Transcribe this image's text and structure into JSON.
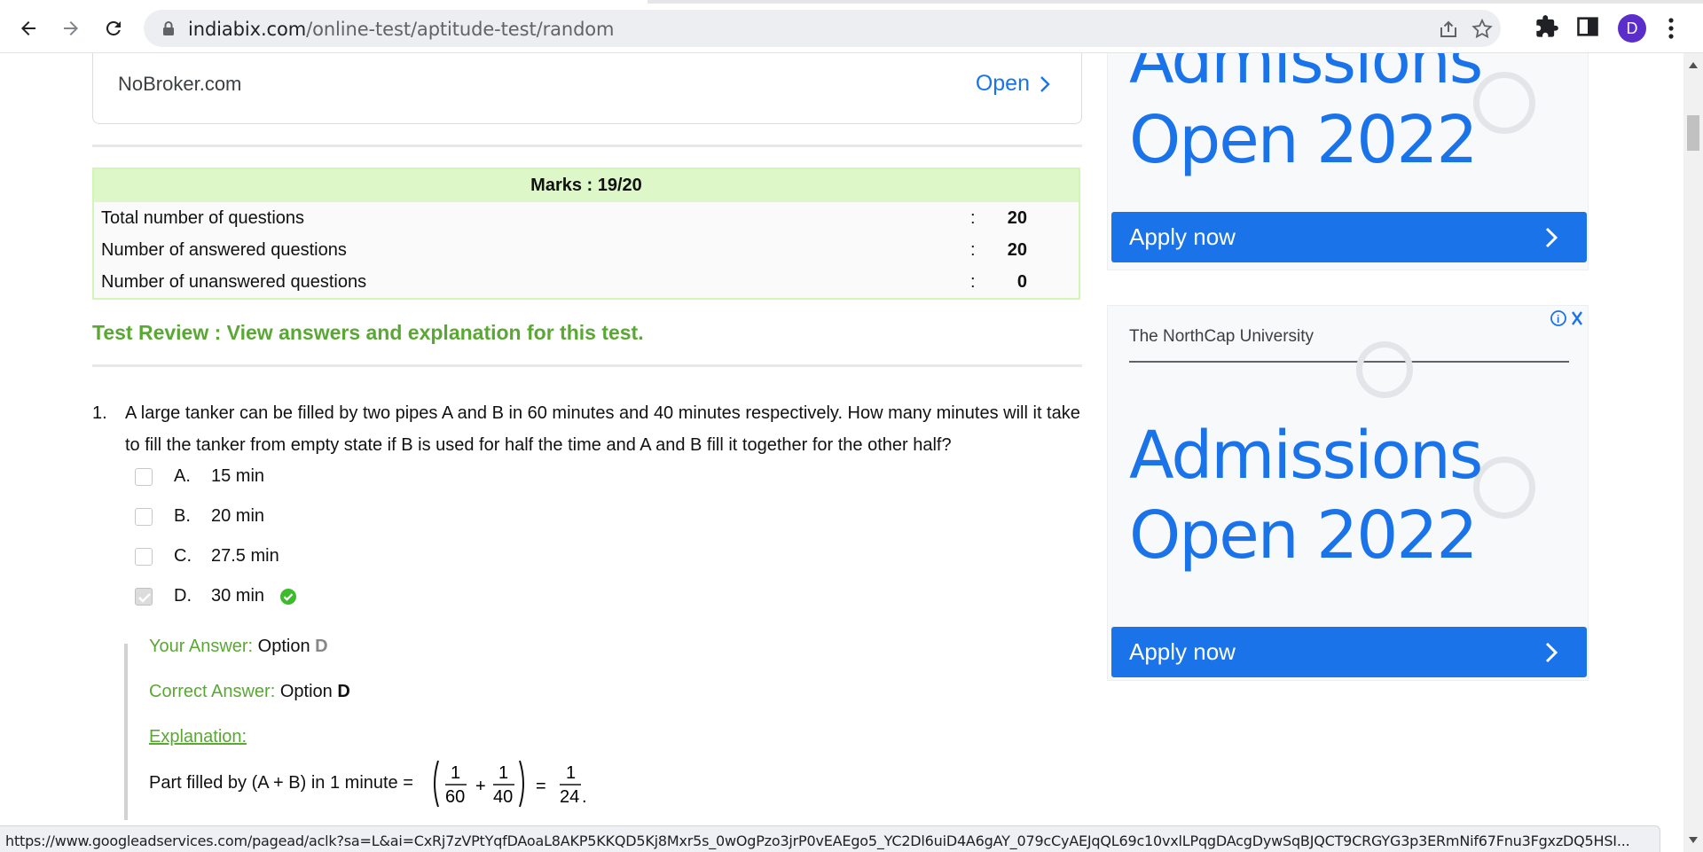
{
  "browser": {
    "url_domain": "indiabix.com",
    "url_path": "/online-test/aptitude-test/random",
    "profile_initial": "D",
    "status_url": "https://www.googleadservices.com/pagead/aclk?sa=L&ai=CxRj7zVPtYqfDAoaL8AKP5KKQD5Kj8Mxr5s_0wOgPzo3jrP0vEAEgo5_YC2Dl6uiD4A6gAY_079cCyAEJqQL69c10vxlLPqgDAcgDywSqBJQCT9CRGYG3p3ERmNif67Fnu3FgxzDQ5HSI..."
  },
  "top_ad": {
    "name": "NoBroker.com",
    "open_label": "Open"
  },
  "marks": {
    "title": "Marks : 19/20",
    "rows": [
      {
        "label": "Total number of questions",
        "colon": ":",
        "value": "20"
      },
      {
        "label": "Number of answered questions",
        "colon": ":",
        "value": "20"
      },
      {
        "label": "Number of unanswered questions",
        "colon": ":",
        "value": "0"
      }
    ]
  },
  "review_link": "Test Review : View answers and explanation for this test.",
  "question": {
    "number": "1.",
    "text": "A large tanker can be filled by two pipes A and B in 60 minutes and 40 minutes respectively. How many minutes will it take to fill the tanker from empty state if B is used for half the time and A and B fill it together for the other half?",
    "options": [
      {
        "letter": "A.",
        "text": "15 min",
        "checked": false
      },
      {
        "letter": "B.",
        "text": "20 min",
        "checked": false
      },
      {
        "letter": "C.",
        "text": "27.5 min",
        "checked": false
      },
      {
        "letter": "D.",
        "text": "30 min",
        "checked": true
      }
    ]
  },
  "answer": {
    "your_label": "Your Answer:",
    "your_value": "Option",
    "your_option": "D",
    "correct_label": "Correct Answer:",
    "correct_value": "Option",
    "correct_option": "D",
    "explanation_label": "Explanation:",
    "formula_text": "Part filled by (A + B) in 1 minute =",
    "frac1_num": "1",
    "frac1_den": "60",
    "plus": "+",
    "frac2_num": "1",
    "frac2_den": "40",
    "equals": "=",
    "frac3_num": "1",
    "frac3_den": "24",
    "period": "."
  },
  "right_ad_1": {
    "headline_top": "Admissions",
    "headline_bottom": "Open 2022",
    "apply_label": "Apply now"
  },
  "right_ad_2": {
    "university": "The NorthCap University",
    "headline_top": "Admissions",
    "headline_bottom": "Open 2022",
    "apply_label": "Apply now"
  },
  "colors": {
    "accent_blue": "#1a73e8",
    "green": "#5aa834",
    "marks_header_bg": "#ddf7c8"
  }
}
